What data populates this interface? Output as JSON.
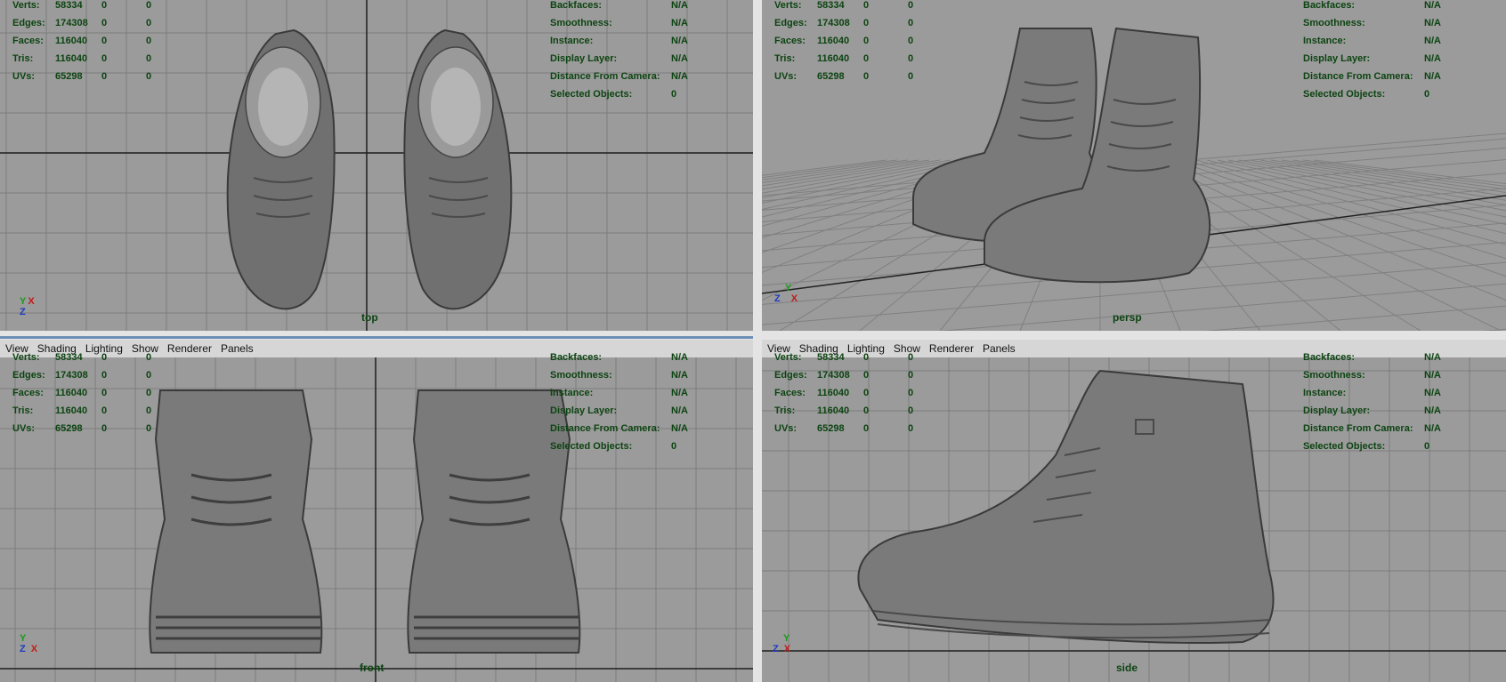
{
  "menu": [
    "View",
    "Shading",
    "Lighting",
    "Show",
    "Renderer",
    "Panels"
  ],
  "stats_left": [
    {
      "label": "Verts:",
      "values": [
        "58334",
        "0",
        "0"
      ]
    },
    {
      "label": "Edges:",
      "values": [
        "174308",
        "0",
        "0"
      ]
    },
    {
      "label": "Faces:",
      "values": [
        "116040",
        "0",
        "0"
      ]
    },
    {
      "label": "Tris:",
      "values": [
        "116040",
        "0",
        "0"
      ]
    },
    {
      "label": "UVs:",
      "values": [
        "65298",
        "0",
        "0"
      ]
    }
  ],
  "stats_right": [
    {
      "label": "Backfaces:",
      "value": "N/A"
    },
    {
      "label": "Smoothness:",
      "value": "N/A"
    },
    {
      "label": "Instance:",
      "value": "N/A"
    },
    {
      "label": "Display Layer:",
      "value": "N/A"
    },
    {
      "label": "Distance From Camera:",
      "value": "N/A"
    },
    {
      "label": "Selected Objects:",
      "value": "0"
    }
  ],
  "viewports": {
    "top": {
      "camera": "top",
      "axes": [
        "Y",
        "X",
        "Z"
      ]
    },
    "persp": {
      "camera": "persp",
      "axes": [
        "Y",
        "Z",
        "X"
      ]
    },
    "front": {
      "camera": "front",
      "axes": [
        "Y",
        "Z",
        "X"
      ]
    },
    "side": {
      "camera": "side",
      "axes": [
        "Y",
        "Z",
        "X"
      ]
    }
  },
  "colors": {
    "hud_text": "#0c4411",
    "viewport_bg": "#9b9b9b",
    "grid_line": "#7a7a7a",
    "model": "#6e6e6e"
  }
}
